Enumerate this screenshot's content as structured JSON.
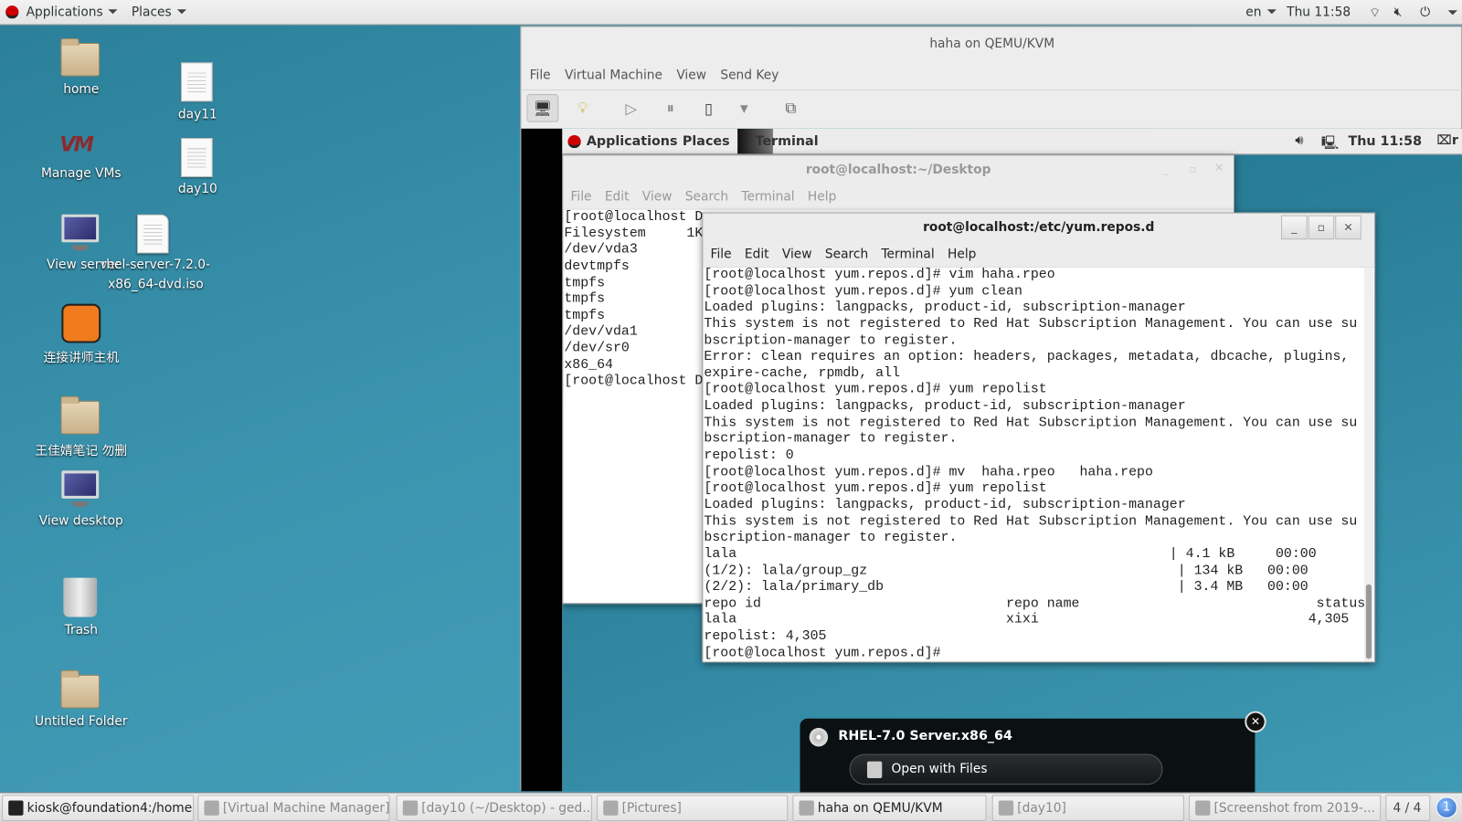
{
  "topbar": {
    "applications": "Applications",
    "places": "Places",
    "lang": "en",
    "clock": "Thu 11:58"
  },
  "desktop": {
    "icons": [
      {
        "label": "home"
      },
      {
        "label": "day11"
      },
      {
        "label": "Manage VMs"
      },
      {
        "label": "day10"
      },
      {
        "label": "View server"
      },
      {
        "label": "rhel-server-7.2.0-",
        "label2": "x86_64-dvd.iso"
      },
      {
        "label": "连接讲师主机"
      },
      {
        "label": "王佳婧笔记 勿删"
      },
      {
        "label": "View desktop"
      },
      {
        "label": "Trash"
      },
      {
        "label": "Untitled Folder"
      }
    ]
  },
  "vm_window": {
    "title": "haha on QEMU/KVM",
    "menu": [
      "File",
      "Virtual Machine",
      "View",
      "Send Key"
    ]
  },
  "guest": {
    "topbar": {
      "applications": "Applications",
      "places": "Places",
      "terminal": "Terminal",
      "clock": "Thu 11:58",
      "user": "r"
    },
    "back_terminal": {
      "title": "root@localhost:~/Desktop",
      "menu": [
        "File",
        "Edit",
        "View",
        "Search",
        "Terminal",
        "Help"
      ],
      "lines": [
        "[root@localhost D",
        "Filesystem     1K",
        "/dev/vda3",
        "devtmpfs",
        "tmpfs",
        "tmpfs",
        "tmpfs",
        "/dev/vda1",
        "/dev/sr0",
        "x86_64",
        "[root@localhost D"
      ]
    },
    "front_terminal": {
      "title": "root@localhost:/etc/yum.repos.d",
      "menu": [
        "File",
        "Edit",
        "View",
        "Search",
        "Terminal",
        "Help"
      ],
      "lines": [
        "[root@localhost yum.repos.d]# vim haha.rpeo",
        "[root@localhost yum.repos.d]# yum clean",
        "Loaded plugins: langpacks, product-id, subscription-manager",
        "This system is not registered to Red Hat Subscription Management. You can use su",
        "bscription-manager to register.",
        "Error: clean requires an option: headers, packages, metadata, dbcache, plugins,",
        "expire-cache, rpmdb, all",
        "[root@localhost yum.repos.d]# yum repolist",
        "Loaded plugins: langpacks, product-id, subscription-manager",
        "This system is not registered to Red Hat Subscription Management. You can use su",
        "bscription-manager to register.",
        "repolist: 0",
        "[root@localhost yum.repos.d]# mv  haha.rpeo   haha.repo",
        "[root@localhost yum.repos.d]# yum repolist",
        "Loaded plugins: langpacks, product-id, subscription-manager",
        "This system is not registered to Red Hat Subscription Management. You can use su",
        "bscription-manager to register.",
        "lala                                                     | 4.1 kB     00:00",
        "(1/2): lala/group_gz                                      | 134 kB   00:00",
        "(2/2): lala/primary_db                                    | 3.4 MB   00:00",
        "repo id                              repo name                             status",
        "lala                                 xixi                                 4,305",
        "repolist: 4,305",
        "[root@localhost yum.repos.d]#"
      ]
    }
  },
  "notification": {
    "title": "RHEL-7.0 Server.x86_64",
    "action": "Open with Files"
  },
  "taskbar": {
    "items": [
      {
        "label": "kiosk@foundation4:/home...",
        "active": true
      },
      {
        "label": "[Virtual Machine Manager]"
      },
      {
        "label": "[day10 (~/Desktop) - ged..."
      },
      {
        "label": "[Pictures]"
      },
      {
        "label": "haha on QEMU/KVM",
        "active": true
      },
      {
        "label": "[day10]"
      },
      {
        "label": "[Screenshot from 2019-..."
      }
    ],
    "workspace": "4 / 4",
    "badge": "1"
  }
}
